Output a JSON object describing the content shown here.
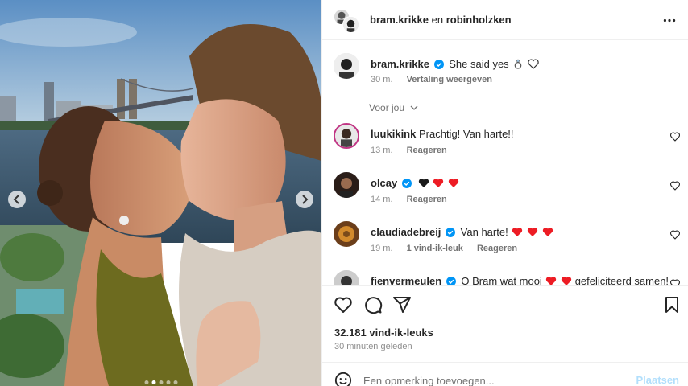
{
  "header": {
    "user1": "bram.krikke",
    "joiner": "en",
    "user2": "robinholzken"
  },
  "caption": {
    "username": "bram.krikke",
    "text": "She said yes",
    "time": "30 m.",
    "translate": "Vertaling weergeven"
  },
  "more_comments": "Voor jou",
  "comments": [
    {
      "username": "luukikink",
      "text": "Prachtig! Van harte!!",
      "time": "13 m.",
      "likes": "",
      "reply": "Reageren",
      "verified": false
    },
    {
      "username": "olcay",
      "text": "",
      "time": "14 m.",
      "likes": "",
      "reply": "Reageren",
      "verified": true
    },
    {
      "username": "claudiadebreij",
      "text": "Van harte!",
      "time": "19 m.",
      "likes": "1 vind-ik-leuk",
      "reply": "Reageren",
      "verified": true
    },
    {
      "username": "fienvermeulen",
      "text": "O Bram wat mooi",
      "text2": "gefeliciteerd samen!",
      "verified": true
    }
  ],
  "stats": {
    "likes": "32.181 vind-ik-leuks",
    "time": "30 minuten geleden"
  },
  "composer": {
    "placeholder": "Een opmerking toevoegen...",
    "post": "Plaatsen"
  },
  "colors": {
    "verified": "#0095f6",
    "heart": "#ed1c24",
    "post_disabled": "#b2dffc"
  },
  "icons": [
    "chevron-left-icon",
    "chevron-right-icon",
    "more-icon",
    "verified-icon",
    "heart-icon",
    "comment-icon",
    "share-icon",
    "bookmark-icon",
    "smile-icon",
    "ring-icon",
    "chevron-down-icon"
  ]
}
